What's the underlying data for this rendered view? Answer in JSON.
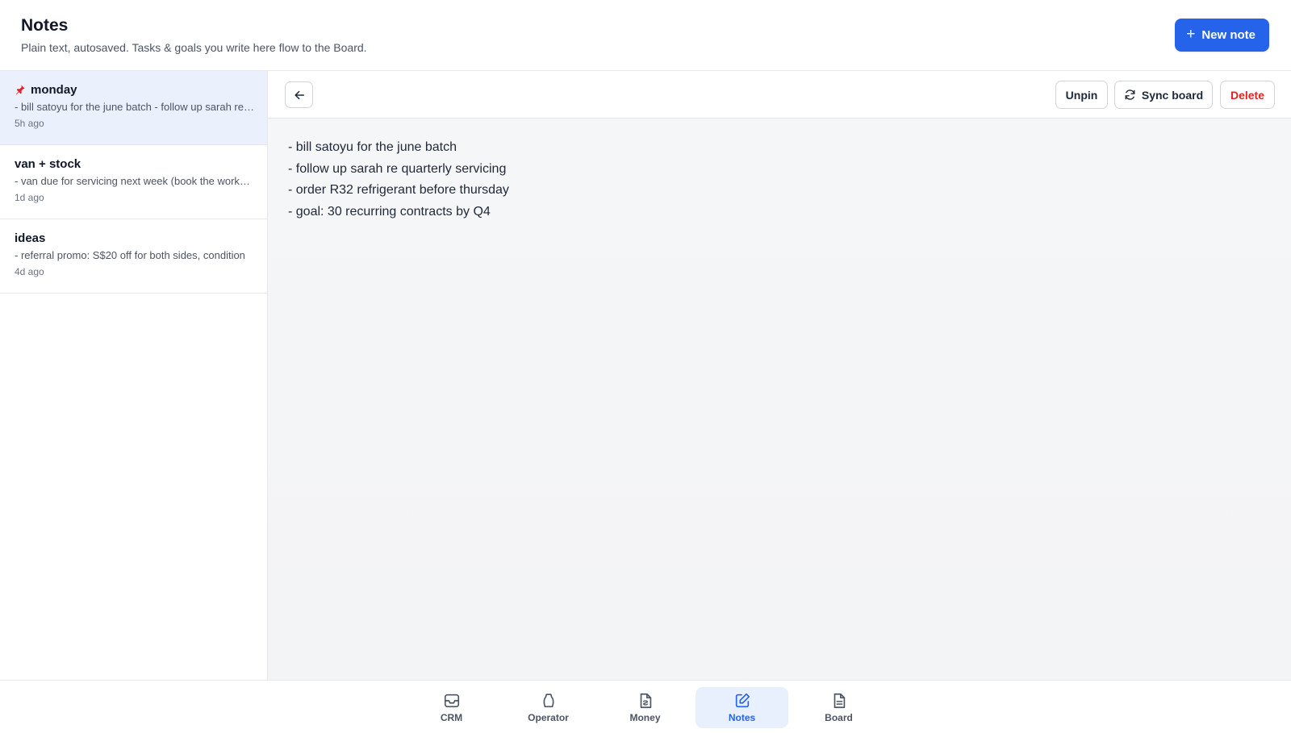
{
  "header": {
    "title": "Notes",
    "subtitle": "Plain text, autosaved. Tasks & goals you write here flow to the Board.",
    "new_note_label": "New note"
  },
  "notes": [
    {
      "title": "monday",
      "preview": "- bill satoyu for the june batch - follow up sarah re quarterly servicing",
      "time": "5h ago",
      "pinned": true,
      "selected": true
    },
    {
      "title": "van + stock",
      "preview": "- van due for servicing next week (book the workshop)",
      "time": "1d ago",
      "pinned": false,
      "selected": false
    },
    {
      "title": "ideas",
      "preview": "- referral promo: S$20 off for both sides, condition",
      "time": "4d ago",
      "pinned": false,
      "selected": false
    }
  ],
  "toolbar": {
    "unpin_label": "Unpin",
    "sync_label": "Sync board",
    "delete_label": "Delete"
  },
  "editor": {
    "lines": [
      "- bill satoyu for the june batch",
      "- follow up sarah re quarterly servicing",
      "- order R32 refrigerant before thursday",
      "- goal: 30 recurring contracts by Q4"
    ]
  },
  "nav": {
    "items": [
      {
        "label": "CRM",
        "icon": "inbox-icon",
        "active": false
      },
      {
        "label": "Operator",
        "icon": "operator-icon",
        "active": false
      },
      {
        "label": "Money",
        "icon": "receipt-icon",
        "active": false
      },
      {
        "label": "Notes",
        "icon": "edit-icon",
        "active": true
      },
      {
        "label": "Board",
        "icon": "document-icon",
        "active": false
      }
    ]
  },
  "colors": {
    "accent": "#2563eb",
    "danger": "#dc2626",
    "selected_bg": "#eaf1fd"
  }
}
